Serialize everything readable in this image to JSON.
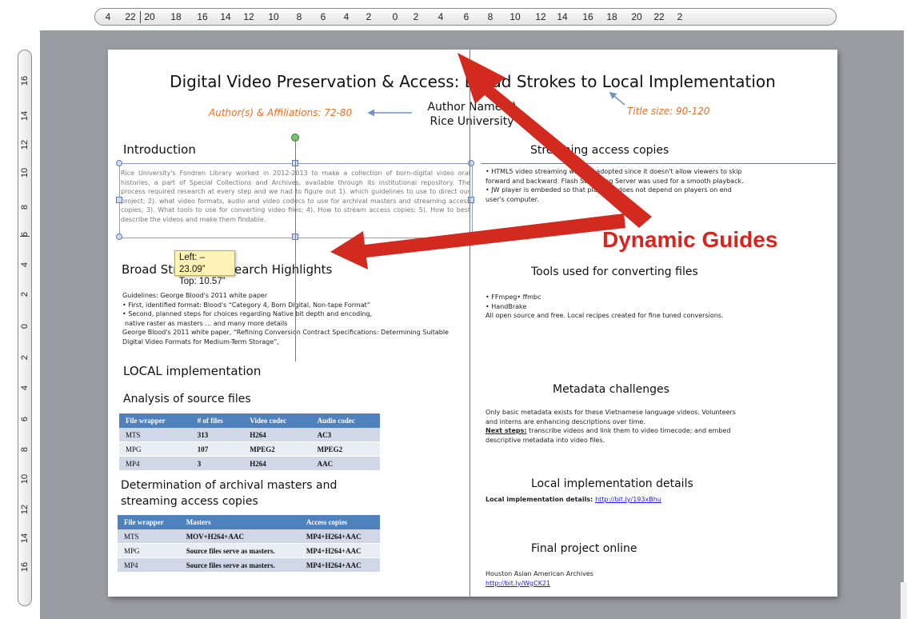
{
  "ruler": {
    "horizontal": [
      "4",
      "22",
      "20",
      "18",
      "16",
      "14",
      "12",
      "10",
      "8",
      "6",
      "4",
      "2",
      "0",
      "2",
      "4",
      "6",
      "8",
      "10",
      "12",
      "14",
      "16",
      "18",
      "20",
      "22",
      "2"
    ],
    "vertical": [
      "16",
      "14",
      "12",
      "10",
      "8",
      "6",
      "4",
      "2",
      "0",
      "2",
      "4",
      "6",
      "8",
      "10",
      "12",
      "14",
      "16"
    ]
  },
  "slide": {
    "title": "Digital Video Preservation & Access: Broad Strokes to Local Implementation",
    "author_hint": "Author(s) & Affiliations: 72-80",
    "author_name": "Author Name(s)",
    "affiliation": "Rice University",
    "title_size_hint": "Title size: 90-120",
    "intro_heading": "Introduction",
    "intro_text": "Rice University's Fondren Library worked in 2012-2013 to make a collection of born-digital video oral histories, a part of Special Collections and Archives, available through its institutional repository. The process required research at every step and we had to figure out 1). which guidelines to use to direct our project; 2). what video formats, audio and video codecs to use for archival masters and streaming access copies; 3). What tools to use for converting video files; 4). How to stream access copies; 5). How to best describe the videos and make them findable.",
    "broad_heading": "Broad Strokes: Research Highlights",
    "broad_lines": [
      "Guidelines: George Blood's 2011 white paper",
      "• First, identified format: Blood's “Category 4, Born Digital, Non-tape Format”",
      "• Second, planned steps for choices regarding Native bit depth and encoding,",
      "native raster as masters … and many more details",
      "George Blood's 2011 white paper, “Refining Conversion Contract Specifications: Determining Suitable",
      "Digital Video Formats for Medium-Term Storage”,"
    ],
    "local_heading": "LOCAL implementation",
    "analysis_heading": "Analysis of source files",
    "table1": {
      "headers": [
        "File wrapper",
        "# of files",
        "Video codec",
        "Audio codec"
      ],
      "rows": [
        [
          "MTS",
          "313",
          "H264",
          "AC3"
        ],
        [
          "MPG",
          "107",
          "MPEG2",
          "MPEG2"
        ],
        [
          "MP4",
          "3",
          "H264",
          "AAC"
        ]
      ]
    },
    "determination_heading_1": "Determination of archival masters and",
    "determination_heading_2": "streaming access copies",
    "table2": {
      "headers": [
        "File wrapper",
        "Masters",
        "Access copies"
      ],
      "rows": [
        [
          "MTS",
          "MOV+H264+AAC",
          "MP4+H264+AAC"
        ],
        [
          "MPG",
          "Source files serve as masters.",
          "MP4+H264+AAC"
        ],
        [
          "MP4",
          "Source files serve as masters.",
          "MP4+H264+AAC"
        ]
      ]
    },
    "streaming_heading": "Streaming access copies",
    "streaming_lines": [
      "• HTML5 video streaming  was not adopted since it doesn't allow viewers to skip",
      "forward and backward. Flash Streaming Server was used for a smooth playback.",
      "• JW player is embeded so that playback does not depend on players on end",
      "user's computer."
    ],
    "tools_heading": "Tools used for converting files",
    "tools_lines": [
      "• FFmpeg• ffmbc",
      "• HandBrake",
      "All open source and free. Local recipes created for fine tuned conversions."
    ],
    "metadata_heading": "Metadata challenges",
    "metadata_lines": [
      "Only basic metadata exists for these Vietnamese language videos.  Volunteers",
      "and interns are enhancing descriptions over time."
    ],
    "next_steps_label": "Next steps:",
    "next_steps_text": "  transcribe videos and link them to video timecode; and embed",
    "next_steps_text_2": "descriptive metadata into video files.",
    "local_details_heading": "Local implementation details",
    "local_details_label": "Local implementation details: ",
    "local_details_link": "http://bit.ly/193xBhu",
    "final_heading": "Final project online",
    "final_text": "Houston Asian American Archives",
    "final_link": "http://bit.ly/WgCK21"
  },
  "tooltip": {
    "left": "Left: –23.09”",
    "top": "Top: 10.57”"
  },
  "annotation": {
    "dynamic_guides": "Dynamic Guides"
  },
  "colors": {
    "canvas": "#999ba1",
    "table_header": "#4f81bd",
    "hint_orange": "#e96f25",
    "annotation_red": "#d8241d"
  }
}
